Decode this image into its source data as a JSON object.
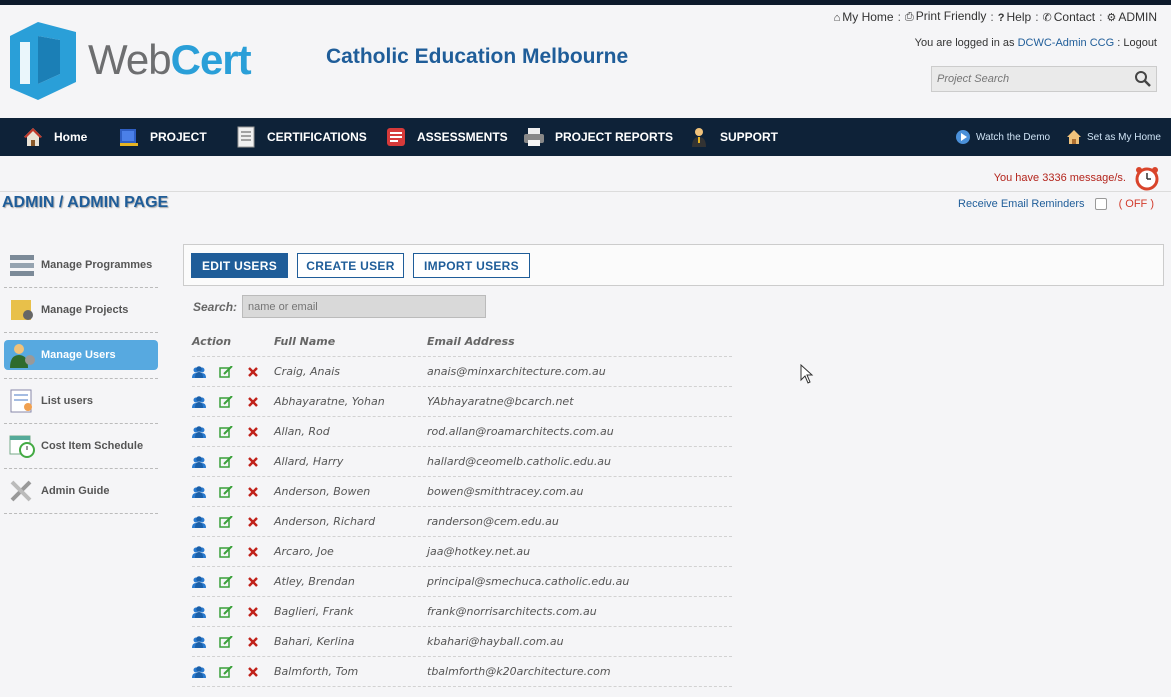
{
  "brand": {
    "web": "Web",
    "cert": "Cert"
  },
  "org_title": "Catholic Education Melbourne",
  "toplinks": {
    "my_home": "My Home",
    "print": "Print Friendly",
    "help": "Help",
    "contact": "Contact",
    "admin": "ADMIN",
    "sep": ":"
  },
  "login": {
    "prefix": "You are logged in as",
    "user": "DCWC-Admin CCG",
    "sep": ":",
    "logout": "Logout"
  },
  "project_search": {
    "placeholder": "Project Search"
  },
  "nav": {
    "home": "Home",
    "project": "PROJECT",
    "certifications": "CERTIFICATIONS",
    "assessments": "ASSESSMENTS",
    "reports": "PROJECT REPORTS",
    "support": "SUPPORT",
    "watch_demo": "Watch the Demo",
    "set_home": "Set as My Home"
  },
  "messages": {
    "text": "You have 3336 message/s."
  },
  "page_title": "ADMIN / ADMIN PAGE",
  "reminder": {
    "label": "Receive Email Reminders",
    "state": "( OFF )"
  },
  "sidebar": {
    "items": [
      {
        "label": "Manage Programmes"
      },
      {
        "label": "Manage Projects"
      },
      {
        "label": "Manage Users"
      },
      {
        "label": "List users"
      },
      {
        "label": "Cost Item Schedule"
      },
      {
        "label": "Admin Guide"
      }
    ]
  },
  "tabs": {
    "edit": "EDIT USERS",
    "create": "CREATE USER",
    "import": "IMPORT USERS"
  },
  "user_search": {
    "label": "Search:",
    "placeholder": "name or email"
  },
  "table": {
    "headers": {
      "action": "Action",
      "name": "Full Name",
      "email": "Email Address"
    },
    "rows": [
      {
        "name": "Craig, Anais",
        "email": "anais@minxarchitecture.com.au"
      },
      {
        "name": "Abhayaratne, Yohan",
        "email": "YAbhayaratne@bcarch.net"
      },
      {
        "name": "Allan, Rod",
        "email": "rod.allan@roamarchitects.com.au"
      },
      {
        "name": "Allard, Harry",
        "email": "hallard@ceomelb.catholic.edu.au"
      },
      {
        "name": "Anderson, Bowen",
        "email": "bowen@smithtracey.com.au"
      },
      {
        "name": "Anderson, Richard",
        "email": "randerson@cem.edu.au"
      },
      {
        "name": "Arcaro, Joe",
        "email": "jaa@hotkey.net.au"
      },
      {
        "name": "Atley, Brendan",
        "email": "principal@smechuca.catholic.edu.au"
      },
      {
        "name": "Baglieri, Frank",
        "email": "frank@norrisarchitects.com.au"
      },
      {
        "name": "Bahari, Kerlina",
        "email": "kbahari@hayball.com.au"
      },
      {
        "name": "Balmforth, Tom",
        "email": "tbalmforth@k20architecture.com"
      }
    ]
  },
  "colors": {
    "accent": "#1f5d99",
    "navbar": "#0e2238",
    "active_side": "#57a9e0",
    "alert": "#b4251d"
  },
  "icons": [
    "home-icon",
    "print-icon",
    "help-icon",
    "phone-icon",
    "gear-icon",
    "search-icon",
    "users-icon",
    "edit-icon",
    "delete-icon",
    "alarm-clock-icon"
  ]
}
